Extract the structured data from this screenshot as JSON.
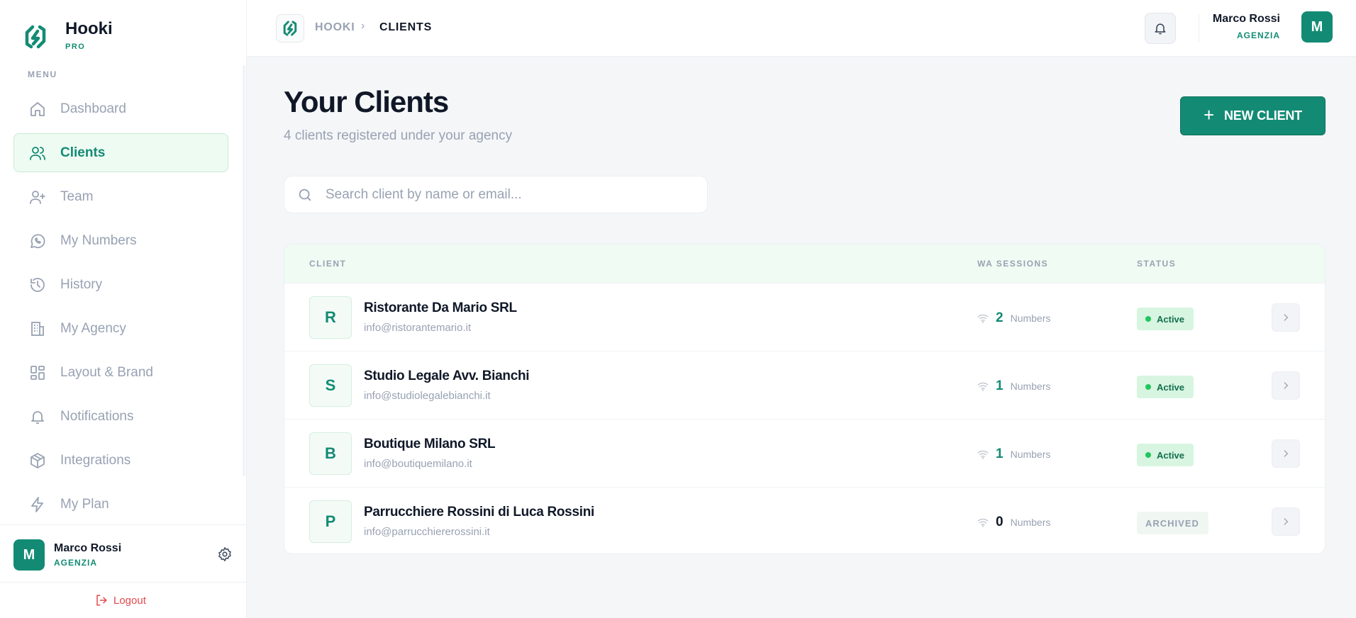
{
  "brand": {
    "name": "Hooki",
    "tier": "PRO"
  },
  "sidebar": {
    "menu_label": "MENU",
    "items": [
      {
        "label": "Dashboard",
        "icon": "home-icon",
        "active": false
      },
      {
        "label": "Clients",
        "icon": "users-icon",
        "active": true
      },
      {
        "label": "Team",
        "icon": "user-plus-icon",
        "active": false
      },
      {
        "label": "My Numbers",
        "icon": "whatsapp-icon",
        "active": false
      },
      {
        "label": "History",
        "icon": "history-icon",
        "active": false
      },
      {
        "label": "My Agency",
        "icon": "building-icon",
        "active": false
      },
      {
        "label": "Layout & Brand",
        "icon": "layout-icon",
        "active": false
      },
      {
        "label": "Notifications",
        "icon": "bell-icon",
        "active": false
      },
      {
        "label": "Integrations",
        "icon": "package-icon",
        "active": false
      },
      {
        "label": "My Plan",
        "icon": "lightning-icon",
        "active": false
      }
    ],
    "user": {
      "initial": "M",
      "name": "Marco Rossi",
      "role": "AGENZIA"
    },
    "logout_label": "Logout"
  },
  "topbar": {
    "breadcrumb": [
      "HOOKI",
      "CLIENTS"
    ],
    "user": {
      "initial": "M",
      "name": "Marco Rossi",
      "role": "AGENZIA"
    }
  },
  "main": {
    "title": "Your Clients",
    "subtitle": "4 clients registered under your agency",
    "new_client_label": "NEW CLIENT",
    "search_placeholder": "Search client by name or email...",
    "table": {
      "headers": {
        "client": "CLIENT",
        "wa_sessions": "WA SESSIONS",
        "status": "STATUS"
      },
      "rows": [
        {
          "initial": "R",
          "name": "Ristorante Da Mario SRL",
          "email": "info@ristorantemario.it",
          "sessions": "2",
          "sessions_label": "Numbers",
          "status": "Active"
        },
        {
          "initial": "S",
          "name": "Studio Legale Avv. Bianchi",
          "email": "info@studiolegalebianchi.it",
          "sessions": "1",
          "sessions_label": "Numbers",
          "status": "Active"
        },
        {
          "initial": "B",
          "name": "Boutique Milano SRL",
          "email": "info@boutiquemilano.it",
          "sessions": "1",
          "sessions_label": "Numbers",
          "status": "Active"
        },
        {
          "initial": "P",
          "name": "Parrucchiere Rossini di Luca Rossini",
          "email": "info@parrucchiererossini.it",
          "sessions": "0",
          "sessions_label": "Numbers",
          "status": "ARCHIVED"
        }
      ]
    }
  },
  "colors": {
    "accent": "#138b74",
    "active_bg": "#eefbf2",
    "danger": "#e5484d"
  }
}
